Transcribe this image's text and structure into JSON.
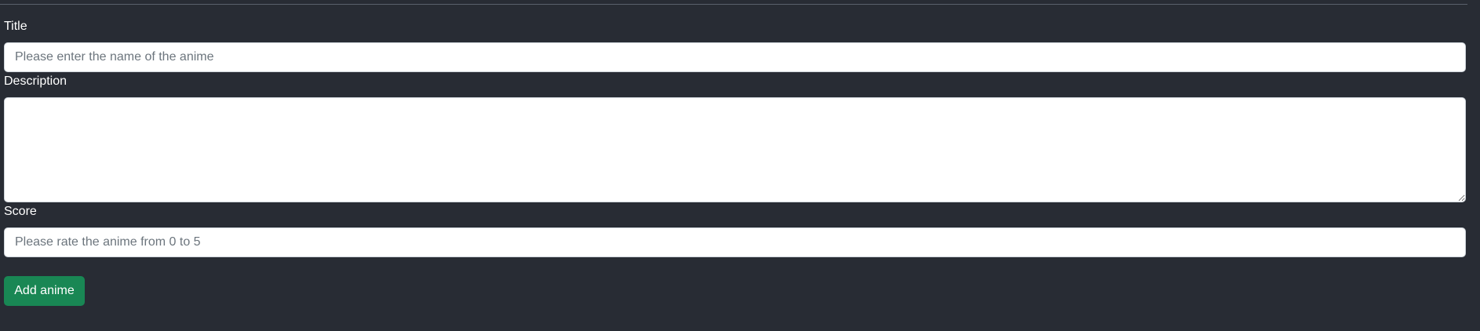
{
  "form": {
    "title": {
      "label": "Title",
      "value": "",
      "placeholder": "Please enter the name of the anime"
    },
    "description": {
      "label": "Description",
      "value": "",
      "placeholder": ""
    },
    "score": {
      "label": "Score",
      "value": "",
      "placeholder": "Please rate the anime from 0 to 5"
    },
    "submit_label": "Add anime"
  },
  "colors": {
    "background": "#282c34",
    "button": "#198754",
    "text": "#ffffff"
  }
}
